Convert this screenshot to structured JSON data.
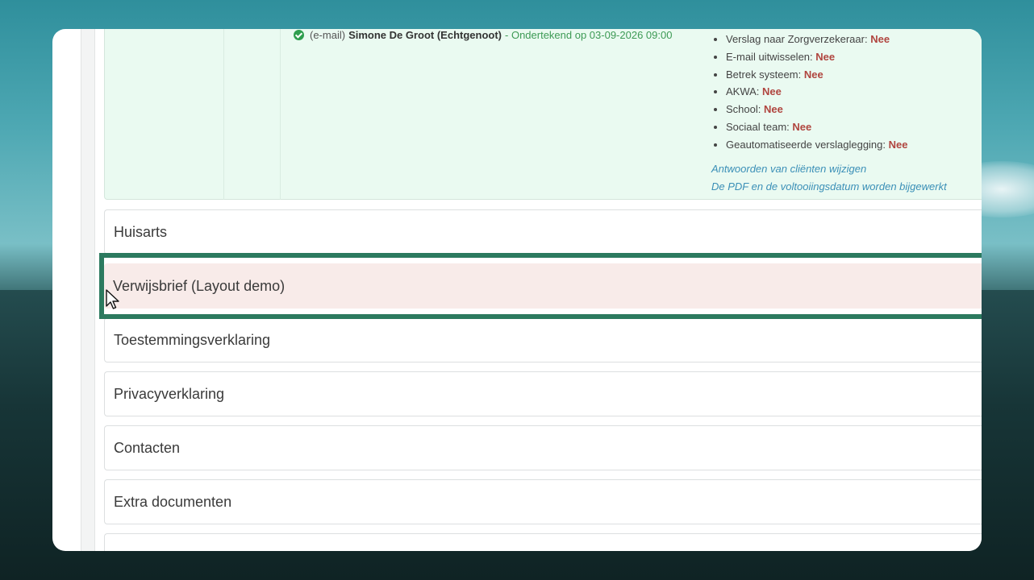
{
  "signature": {
    "method": "(e-mail)",
    "name": "Simone De Groot (Echtgenoot)",
    "status": "- Ondertekend op 03-09-2026 09:00"
  },
  "consents": [
    {
      "label": "Verslag naar Zorgverzekeraar:",
      "value": "Nee"
    },
    {
      "label": "E-mail uitwisselen:",
      "value": "Nee"
    },
    {
      "label": "Betrek systeem:",
      "value": "Nee"
    },
    {
      "label": "AKWA:",
      "value": "Nee"
    },
    {
      "label": "School:",
      "value": "Nee"
    },
    {
      "label": "Sociaal team:",
      "value": "Nee"
    },
    {
      "label": "Geautomatiseerde verslaglegging:",
      "value": "Nee"
    }
  ],
  "links": {
    "edit_answers": "Antwoorden van cliënten wijzigen",
    "pdf_note": "De PDF en de voltooiingsdatum worden bijgewerkt"
  },
  "sections": [
    {
      "label": "Huisarts"
    },
    {
      "label": "Verwijsbrief (Layout demo)"
    },
    {
      "label": "Toestemmingsverklaring"
    },
    {
      "label": "Privacyverklaring"
    },
    {
      "label": "Contacten"
    },
    {
      "label": "Extra documenten"
    },
    {
      "label": ""
    }
  ],
  "colors": {
    "highlight_border": "#2c7a5f",
    "highlight_fill": "#f8ebe9",
    "panel_fill": "#eafaf1",
    "negative_value": "#b0453f",
    "signed_status": "#3d9a55",
    "link": "#3a8fb7"
  }
}
